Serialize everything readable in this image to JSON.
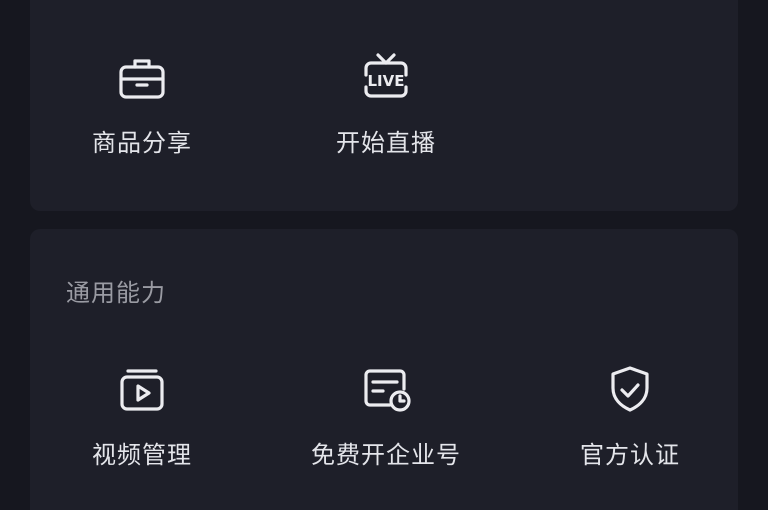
{
  "top_section": {
    "items": [
      {
        "label": "商品分享",
        "icon": "shopping-box-icon"
      },
      {
        "label": "开始直播",
        "icon": "live-tv-icon",
        "icon_text": "LIVE"
      }
    ]
  },
  "general_section": {
    "title": "通用能力",
    "items": [
      {
        "label": "视频管理",
        "icon": "video-manage-icon"
      },
      {
        "label": "免费开企业号",
        "icon": "enterprise-account-icon"
      },
      {
        "label": "官方认证",
        "icon": "shield-check-icon"
      }
    ]
  },
  "colors": {
    "background": "#16171f",
    "card": "#1e1f29",
    "text": "#e4e5ea",
    "muted_text": "#9a9ba3",
    "icon_stroke": "#ececf0"
  }
}
